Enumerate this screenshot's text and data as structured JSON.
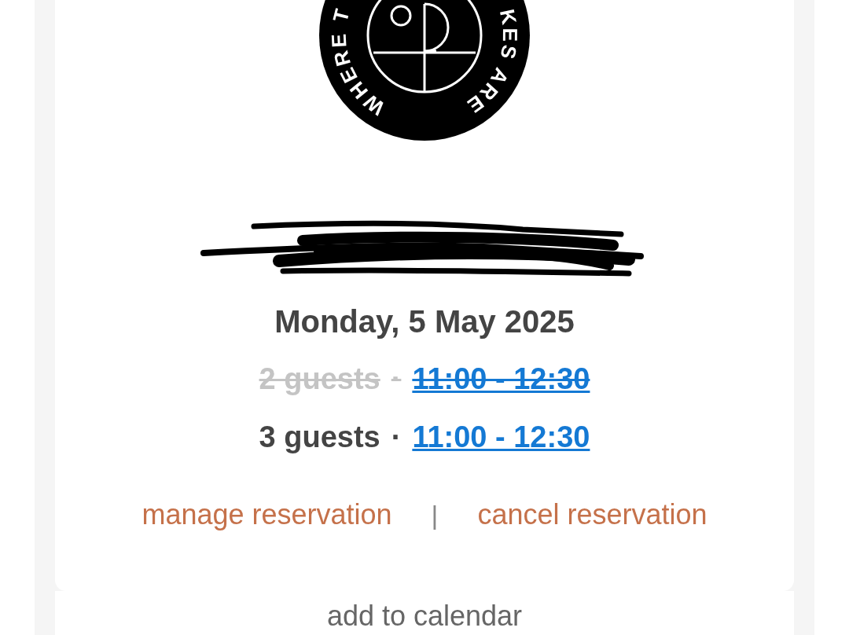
{
  "logo": {
    "ring_text": [
      "WHERE T",
      "KES ARE"
    ]
  },
  "reservation": {
    "date": "Monday, 5 May 2025",
    "lines": [
      {
        "guests": "2 guests",
        "separator": "·",
        "time": "11:00 - 12:30",
        "struck": true
      },
      {
        "guests": "3 guests",
        "separator": "·",
        "time": "11:00 - 12:30",
        "struck": false
      }
    ]
  },
  "actions": [
    {
      "label": "manage reservation"
    },
    {
      "label": "cancel reservation"
    }
  ],
  "divider": "|",
  "footer": {
    "label": "add to calendar"
  }
}
